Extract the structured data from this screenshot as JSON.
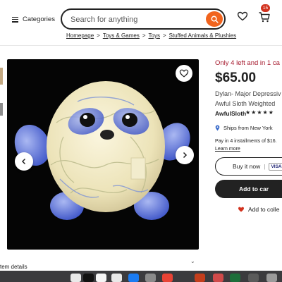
{
  "header": {
    "categories_label": "Categories",
    "search_placeholder": "Search for anything",
    "cart_count": "15"
  },
  "breadcrumb": [
    "Homepage",
    "Toys & Games",
    "Toys",
    "Stuffed Animals & Plushies"
  ],
  "product": {
    "stock_notice": "Only 4 left and in 1 ca",
    "price": "$65.00",
    "title_line1": "Dylan- Major Depressiv",
    "title_line2": "Awful Sloth Weighted",
    "shop_name": "AwfulSloth",
    "stars": "★★★★★",
    "ships_from": "Ships from New York",
    "installments": "Pay in 4 installments of $16.",
    "learn_more": "Learn more",
    "buy_now_label": "Buy it now",
    "payment_badge": "VISA",
    "add_to_cart_label": "Add to car",
    "add_to_collection_label": "Add to colle"
  },
  "footer": {
    "item_details_label": "tem details"
  },
  "colors": {
    "accent": "#f1641e",
    "stock_red": "#a61a2e",
    "badge": "#d2321e",
    "dark_button": "#222222"
  }
}
